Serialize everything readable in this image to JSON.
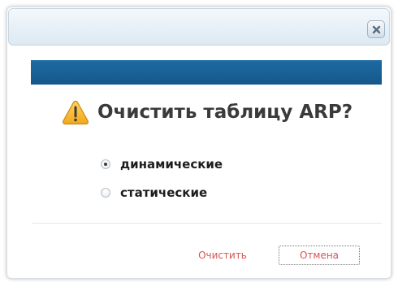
{
  "dialog": {
    "close_icon": "close-icon",
    "warning_icon": "warning-triangle-icon",
    "title": "Очистить таблицу ARP?",
    "options": [
      {
        "label": "динамические",
        "checked": true
      },
      {
        "label": "статические",
        "checked": false
      }
    ],
    "confirm_label": "Очистить",
    "cancel_label": "Отмена"
  },
  "colors": {
    "header_bar": "#1a6199",
    "button_text": "#d9534f",
    "warning_fill": "#f6b92a"
  }
}
